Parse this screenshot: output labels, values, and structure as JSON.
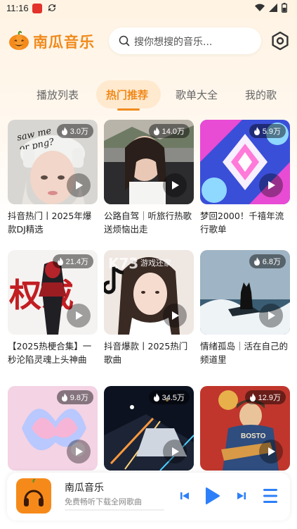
{
  "status": {
    "time": "11:16"
  },
  "header": {
    "app_name": "南瓜音乐",
    "search_placeholder": "搜你想搜的音乐..."
  },
  "tabs": [
    {
      "label": "播放列表",
      "active": false
    },
    {
      "label": "热门推荐",
      "active": true
    },
    {
      "label": "歌单大全",
      "active": false
    },
    {
      "label": "我的歌",
      "active": false
    }
  ],
  "cards": [
    {
      "count": "3.0万",
      "title": "抖音热门丨2025年爆款DJ精选"
    },
    {
      "count": "14.0万",
      "title": "公路自驾｜听旅行热歌送烦恼出走"
    },
    {
      "count": "5.9万",
      "title": "梦回2000！千禧年流行歌单"
    },
    {
      "count": "21.4万",
      "title": "【2025热梗合集】一秒沦陷灵魂上头神曲"
    },
    {
      "count": "",
      "title": "抖音爆款丨2025热门歌曲"
    },
    {
      "count": "6.8万",
      "title": "情绪孤岛｜活在自己的频道里"
    },
    {
      "count": "9.8万",
      "title": ""
    },
    {
      "count": "34.5万",
      "title": ""
    },
    {
      "count": "12.9万",
      "title": ""
    }
  ],
  "cover_text": {
    "card1": "saw me\nor png?",
    "card4": "权戒",
    "card5_watermark": "游戏还家",
    "card9": "BOSTO"
  },
  "player": {
    "title": "南瓜音乐",
    "subtitle": "免费畅听下载全网歌曲",
    "progress": 0
  },
  "colors": {
    "accent": "#f08a1c",
    "tab_active_bg": "#ffe9cf"
  }
}
